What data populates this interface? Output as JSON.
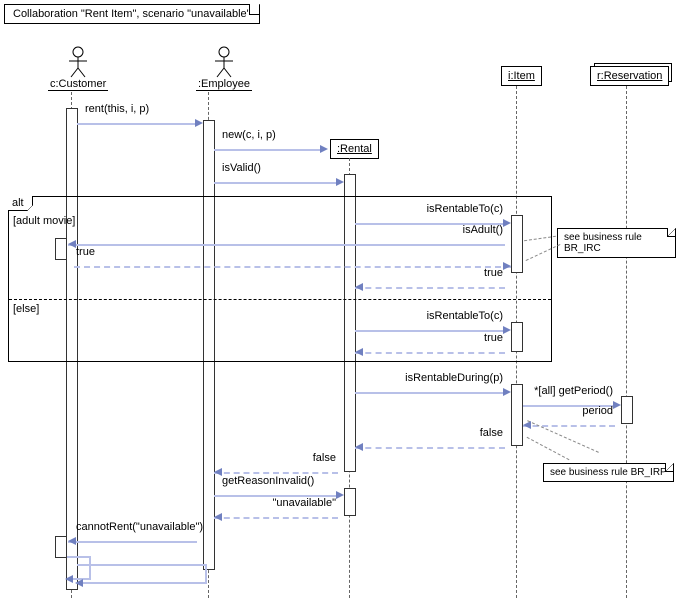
{
  "title": "Collaboration \"Rent Item\", scenario \"unavailable\"",
  "lifelines": {
    "customer": "c:Customer",
    "employee": ":Employee",
    "rental": ":Rental",
    "item": "i:Item",
    "reservation": "r:Reservation"
  },
  "messages": {
    "m1": "rent(this, i, p)",
    "m2": "new(c, i, p)",
    "m3": "isValid()",
    "m4a": "isRentableTo(c)",
    "m5": "isAdult()",
    "m6": "true",
    "m7": "true",
    "m4b": "isRentableTo(c)",
    "m8": "true",
    "m9": "isRentableDuring(p)",
    "m10": "*[all] getPeriod()",
    "m11": "period",
    "m12": "false",
    "m13": "false",
    "m14": "getReasonInvalid()",
    "m15": "\"unavailable\"",
    "m16": "cannotRent(\"unavailable\")"
  },
  "frame": {
    "operator": "alt",
    "guard1": "[adult movie]",
    "guard2": "[else]"
  },
  "notes": {
    "n1": "see business rule BR_IRC",
    "n2": "see business rule BR_IRP"
  }
}
